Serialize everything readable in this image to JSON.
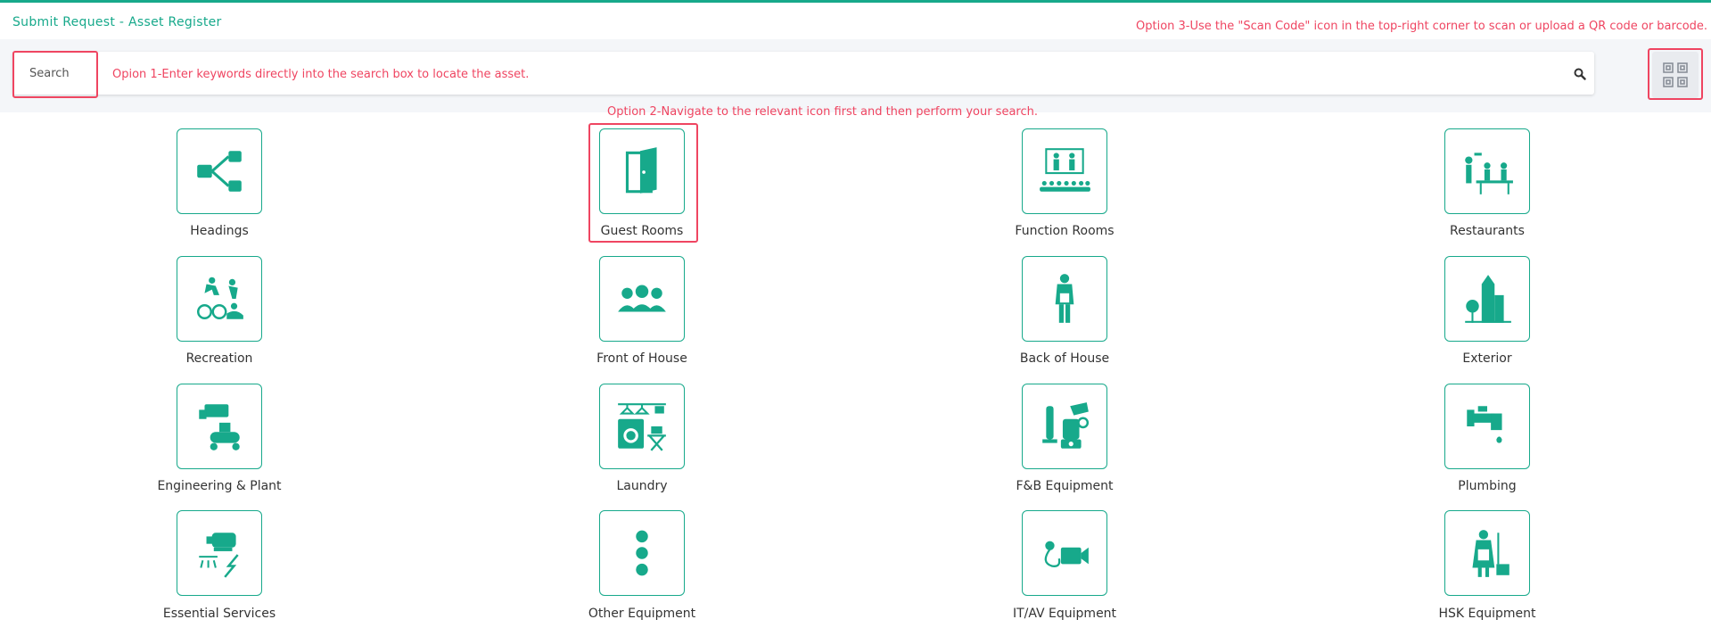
{
  "header": {
    "title": "Submit Request - Asset Register"
  },
  "annotations": {
    "option1": "Opion 1-Enter keywords directly into the search box to locate the asset.",
    "option2": "Option 2-Navigate to the relevant icon first and then perform your search.",
    "option3": "Option 3-Use the \"Scan Code\" icon in the top-right corner to scan or upload a QR code or barcode."
  },
  "search": {
    "placeholder": "Search"
  },
  "colors": {
    "accent": "#17a98b",
    "annotation": "#ef4561"
  },
  "categories": [
    {
      "label": "Headings",
      "icon": "hierarchy-icon"
    },
    {
      "label": "Guest Rooms",
      "icon": "door-icon"
    },
    {
      "label": "Function Rooms",
      "icon": "presentation-icon"
    },
    {
      "label": "Restaurants",
      "icon": "dining-icon"
    },
    {
      "label": "Recreation",
      "icon": "sports-icon"
    },
    {
      "label": "Front of House",
      "icon": "people-icon"
    },
    {
      "label": "Back of House",
      "icon": "staff-icon"
    },
    {
      "label": "Exterior",
      "icon": "buildings-icon"
    },
    {
      "label": "Engineering & Plant",
      "icon": "machinery-icon"
    },
    {
      "label": "Laundry",
      "icon": "washing-machine-icon"
    },
    {
      "label": "F&B Equipment",
      "icon": "mixer-icon"
    },
    {
      "label": "Plumbing",
      "icon": "tap-icon"
    },
    {
      "label": "Essential Services",
      "icon": "generator-icon"
    },
    {
      "label": "Other Equipment",
      "icon": "dots-icon"
    },
    {
      "label": "IT/AV Equipment",
      "icon": "camera-icon"
    },
    {
      "label": "HSK Equipment",
      "icon": "housekeeping-icon"
    }
  ]
}
